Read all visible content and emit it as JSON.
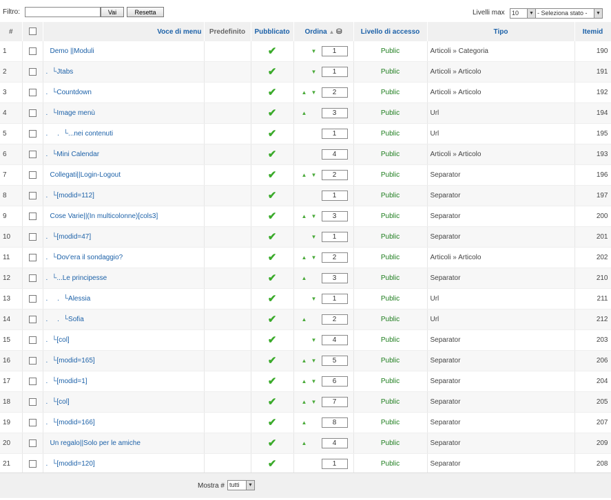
{
  "filter": {
    "label": "Filtro:",
    "value": "",
    "go_label": "Vai",
    "reset_label": "Resetta",
    "levels_label": "Livelli max",
    "levels_value": "10",
    "state_value": "- Seleziona stato -"
  },
  "columns": {
    "num": "#",
    "title": "Voce di menu",
    "default": "Predefinito",
    "published": "Pubblicato",
    "order": "Ordina",
    "access": "Livello di accesso",
    "type": "Tipo",
    "itemid": "Itemid"
  },
  "rows": [
    {
      "n": "1",
      "dots": "",
      "title": "Demo ||Moduli",
      "up": false,
      "down": true,
      "order": "1",
      "access": "Public",
      "type": "Articoli » Categoria",
      "id": "190"
    },
    {
      "n": "2",
      "dots": ".",
      "title": "└Jtabs",
      "up": false,
      "down": true,
      "order": "1",
      "access": "Public",
      "type": "Articoli » Articolo",
      "id": "191"
    },
    {
      "n": "3",
      "dots": ".",
      "title": "└Countdown",
      "up": true,
      "down": true,
      "order": "2",
      "access": "Public",
      "type": "Articoli » Articolo",
      "id": "192"
    },
    {
      "n": "4",
      "dots": ".",
      "title": "└Image menù",
      "up": true,
      "down": false,
      "order": "3",
      "access": "Public",
      "type": "Url",
      "id": "194"
    },
    {
      "n": "5",
      "dots": ".     .",
      "title": "└...nei contenuti",
      "up": false,
      "down": false,
      "order": "1",
      "access": "Public",
      "type": "Url",
      "id": "195"
    },
    {
      "n": "6",
      "dots": ".",
      "title": "└Mini Calendar",
      "up": false,
      "down": false,
      "order": "4",
      "access": "Public",
      "type": "Articoli » Articolo",
      "id": "193"
    },
    {
      "n": "7",
      "dots": "",
      "title": "Collegati||Login-Logout",
      "up": true,
      "down": true,
      "order": "2",
      "access": "Public",
      "type": "Separator",
      "id": "196"
    },
    {
      "n": "8",
      "dots": ".",
      "title": "└[modid=112]",
      "up": false,
      "down": false,
      "order": "1",
      "access": "Public",
      "type": "Separator",
      "id": "197"
    },
    {
      "n": "9",
      "dots": "",
      "title": "Cose Varie||(In multicolonne)[cols3]",
      "up": true,
      "down": true,
      "order": "3",
      "access": "Public",
      "type": "Separator",
      "id": "200"
    },
    {
      "n": "10",
      "dots": ".",
      "title": "└[modid=47]",
      "up": false,
      "down": true,
      "order": "1",
      "access": "Public",
      "type": "Separator",
      "id": "201"
    },
    {
      "n": "11",
      "dots": ".",
      "title": "└Dov'era il sondaggio?",
      "up": true,
      "down": true,
      "order": "2",
      "access": "Public",
      "type": "Articoli » Articolo",
      "id": "202"
    },
    {
      "n": "12",
      "dots": ".",
      "title": "└...Le principesse",
      "up": true,
      "down": false,
      "order": "3",
      "access": "Public",
      "type": "Separator",
      "id": "210"
    },
    {
      "n": "13",
      "dots": ".     .",
      "title": "└Alessia",
      "up": false,
      "down": true,
      "order": "1",
      "access": "Public",
      "type": "Url",
      "id": "211"
    },
    {
      "n": "14",
      "dots": ".     .",
      "title": "└Sofia",
      "up": true,
      "down": false,
      "order": "2",
      "access": "Public",
      "type": "Url",
      "id": "212"
    },
    {
      "n": "15",
      "dots": ".",
      "title": "└[col]",
      "up": false,
      "down": true,
      "order": "4",
      "access": "Public",
      "type": "Separator",
      "id": "203"
    },
    {
      "n": "16",
      "dots": ".",
      "title": "└[modid=165]",
      "up": true,
      "down": true,
      "order": "5",
      "access": "Public",
      "type": "Separator",
      "id": "206"
    },
    {
      "n": "17",
      "dots": ".",
      "title": "└[modid=1]",
      "up": true,
      "down": true,
      "order": "6",
      "access": "Public",
      "type": "Separator",
      "id": "204"
    },
    {
      "n": "18",
      "dots": ".",
      "title": "└[col]",
      "up": true,
      "down": true,
      "order": "7",
      "access": "Public",
      "type": "Separator",
      "id": "205"
    },
    {
      "n": "19",
      "dots": ".",
      "title": "└[modid=166]",
      "up": true,
      "down": false,
      "order": "8",
      "access": "Public",
      "type": "Separator",
      "id": "207"
    },
    {
      "n": "20",
      "dots": "",
      "title": "Un regalo||Solo per le amiche",
      "up": true,
      "down": false,
      "order": "4",
      "access": "Public",
      "type": "Separator",
      "id": "209"
    },
    {
      "n": "21",
      "dots": ".",
      "title": "└[modid=120]",
      "up": false,
      "down": false,
      "order": "1",
      "access": "Public",
      "type": "Separator",
      "id": "208"
    }
  ],
  "pager": {
    "label": "Mostra #",
    "value": "tutti"
  }
}
